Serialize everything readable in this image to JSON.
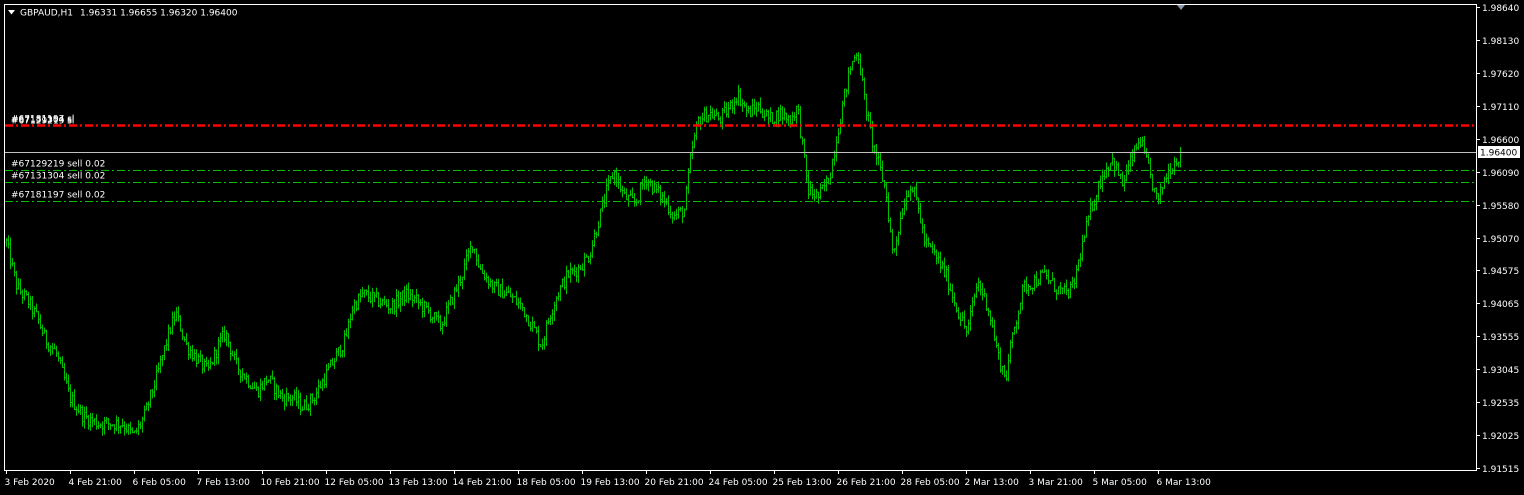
{
  "header": {
    "symbol": "GBPAUD,H1",
    "ohlc": "1.96331 1.96655 1.96320 1.96400"
  },
  "current_price": "1.96400",
  "orders": [
    {
      "label": "#67129219 sell 0.02",
      "price": 1.9612
    },
    {
      "label": "#67131304 sell 0.02",
      "price": 1.9593
    },
    {
      "label": "#67181197 sell 0.02",
      "price": 1.9564
    }
  ],
  "stop_lines": [
    {
      "label": "#67181197 sl",
      "price": 1.9681
    },
    {
      "label": "#67131304 sl",
      "price": 1.9681
    },
    {
      "label": "#67129219 sl",
      "price": 1.9681
    }
  ],
  "colors": {
    "background": "#000000",
    "bars": "#00c000",
    "axis": "#ffffff",
    "stop_loss": "#ff0000",
    "order": "#00c000",
    "bid_line": "#c0c0c0",
    "price_tag_bg": "#ffffff",
    "price_tag_text": "#000000",
    "scroll_marker": "#8899aa"
  },
  "icons": {
    "collapse": "triangle-down-icon",
    "scroll_marker": "chart-shift-triangle-icon"
  },
  "chart_data": {
    "type": "ohlc-bar",
    "title": "GBPAUD,H1",
    "ylim": [
      1.9151,
      1.9864
    ],
    "y_ticks": [
      {
        "value": 1.9864,
        "label": "1.98640"
      },
      {
        "value": 1.9813,
        "label": "1.98130"
      },
      {
        "value": 1.9762,
        "label": "1.97620"
      },
      {
        "value": 1.9711,
        "label": "1.97110"
      },
      {
        "value": 1.966,
        "label": "1.96600"
      },
      {
        "value": 1.9609,
        "label": "1.96090"
      },
      {
        "value": 1.9558,
        "label": "1.95580"
      },
      {
        "value": 1.9507,
        "label": "1.95070"
      },
      {
        "value": 1.94575,
        "label": "1.94575"
      },
      {
        "value": 1.94065,
        "label": "1.94065"
      },
      {
        "value": 1.93555,
        "label": "1.93555"
      },
      {
        "value": 1.93045,
        "label": "1.93045"
      },
      {
        "value": 1.92535,
        "label": "1.92535"
      },
      {
        "value": 1.92025,
        "label": "1.92025"
      },
      {
        "value": 1.91515,
        "label": "1.91515"
      }
    ],
    "x_ticks": [
      {
        "index": 0,
        "label": "3 Feb 2020"
      },
      {
        "index": 32,
        "label": "4 Feb 21:00"
      },
      {
        "index": 64,
        "label": "6 Feb 05:00"
      },
      {
        "index": 96,
        "label": "7 Feb 13:00"
      },
      {
        "index": 128,
        "label": "10 Feb 21:00"
      },
      {
        "index": 160,
        "label": "12 Feb 05:00"
      },
      {
        "index": 192,
        "label": "13 Feb 13:00"
      },
      {
        "index": 224,
        "label": "14 Feb 21:00"
      },
      {
        "index": 256,
        "label": "18 Feb 05:00"
      },
      {
        "index": 288,
        "label": "19 Feb 13:00"
      },
      {
        "index": 320,
        "label": "20 Feb 21:00"
      },
      {
        "index": 352,
        "label": "24 Feb 05:00"
      },
      {
        "index": 384,
        "label": "25 Feb 13:00"
      },
      {
        "index": 416,
        "label": "26 Feb 21:00"
      },
      {
        "index": 448,
        "label": "28 Feb 05:00"
      },
      {
        "index": 480,
        "label": "2 Mar 13:00"
      },
      {
        "index": 512,
        "label": "3 Mar 21:00"
      },
      {
        "index": 544,
        "label": "5 Mar 05:00"
      },
      {
        "index": 576,
        "label": "6 Mar 13:00"
      }
    ],
    "bar_count": 588,
    "path_anchors": [
      [
        0,
        1.95
      ],
      [
        6,
        1.943
      ],
      [
        12,
        1.941
      ],
      [
        18,
        1.938
      ],
      [
        22,
        1.935
      ],
      [
        28,
        1.933
      ],
      [
        36,
        1.926
      ],
      [
        44,
        1.923
      ],
      [
        52,
        1.922
      ],
      [
        58,
        1.922
      ],
      [
        66,
        1.922
      ],
      [
        72,
        1.92
      ],
      [
        78,
        1.923
      ],
      [
        86,
        1.93
      ],
      [
        92,
        1.936
      ],
      [
        96,
        1.939
      ],
      [
        102,
        1.934
      ],
      [
        108,
        1.932
      ],
      [
        114,
        1.93
      ],
      [
        120,
        1.934
      ],
      [
        124,
        1.936
      ],
      [
        130,
        1.931
      ],
      [
        136,
        1.929
      ],
      [
        142,
        1.927
      ],
      [
        148,
        1.929
      ],
      [
        156,
        1.926
      ],
      [
        162,
        1.926
      ],
      [
        168,
        1.9245
      ],
      [
        174,
        1.926
      ],
      [
        180,
        1.929
      ],
      [
        186,
        1.932
      ],
      [
        192,
        1.935
      ],
      [
        196,
        1.94
      ],
      [
        202,
        1.942
      ],
      [
        210,
        1.941
      ],
      [
        218,
        1.94
      ],
      [
        226,
        1.942
      ],
      [
        232,
        1.941
      ],
      [
        240,
        1.939
      ],
      [
        246,
        1.937
      ],
      [
        252,
        1.941
      ],
      [
        258,
        1.945
      ],
      [
        264,
        1.95
      ],
      [
        268,
        1.946
      ],
      [
        276,
        1.943
      ],
      [
        284,
        1.942
      ],
      [
        292,
        1.94
      ],
      [
        298,
        1.937
      ],
      [
        303,
        1.934
      ],
      [
        308,
        1.939
      ],
      [
        312,
        1.942
      ],
      [
        318,
        1.945
      ],
      [
        324,
        1.946
      ],
      [
        330,
        1.948
      ],
      [
        336,
        1.954
      ],
      [
        340,
        1.958
      ],
      [
        344,
        1.961
      ],
      [
        350,
        1.957
      ],
      [
        356,
        1.956
      ],
      [
        362,
        1.96
      ],
      [
        368,
        1.958
      ],
      [
        374,
        1.956
      ],
      [
        378,
        1.954
      ],
      [
        384,
        1.955
      ],
      [
        388,
        1.964
      ],
      [
        392,
        1.969
      ],
      [
        398,
        1.97
      ],
      [
        404,
        1.969
      ],
      [
        410,
        1.971
      ],
      [
        414,
        1.973
      ],
      [
        420,
        1.97
      ],
      [
        426,
        1.971
      ],
      [
        432,
        1.969
      ],
      [
        438,
        1.97
      ],
      [
        444,
        1.969
      ],
      [
        448,
        1.971
      ],
      [
        454,
        1.958
      ],
      [
        460,
        1.957
      ],
      [
        466,
        1.96
      ],
      [
        470,
        1.966
      ],
      [
        474,
        1.972
      ],
      [
        478,
        1.977
      ],
      [
        482,
        1.98
      ],
      [
        486,
        1.972
      ],
      [
        490,
        1.966
      ],
      [
        494,
        1.962
      ],
      [
        498,
        1.958
      ],
      [
        502,
        1.948
      ],
      [
        508,
        1.956
      ],
      [
        512,
        1.959
      ],
      [
        516,
        1.956
      ],
      [
        520,
        1.95
      ],
      [
        526,
        1.948
      ],
      [
        532,
        1.945
      ],
      [
        538,
        1.94
      ],
      [
        544,
        1.936
      ],
      [
        550,
        1.944
      ],
      [
        556,
        1.94
      ],
      [
        562,
        1.932
      ],
      [
        566,
        1.929
      ],
      [
        570,
        1.936
      ],
      [
        576,
        1.943
      ],
      [
        582,
        1.944
      ],
      [
        588,
        1.945
      ],
      [
        594,
        1.943
      ],
      [
        600,
        1.942
      ],
      [
        604,
        1.943
      ],
      [
        608,
        1.948
      ],
      [
        614,
        1.955
      ],
      [
        620,
        1.96
      ],
      [
        626,
        1.963
      ],
      [
        632,
        1.959
      ],
      [
        636,
        1.962
      ],
      [
        642,
        1.966
      ],
      [
        648,
        1.96
      ],
      [
        652,
        1.956
      ],
      [
        656,
        1.96
      ],
      [
        660,
        1.962
      ],
      [
        666,
        1.964
      ]
    ]
  }
}
